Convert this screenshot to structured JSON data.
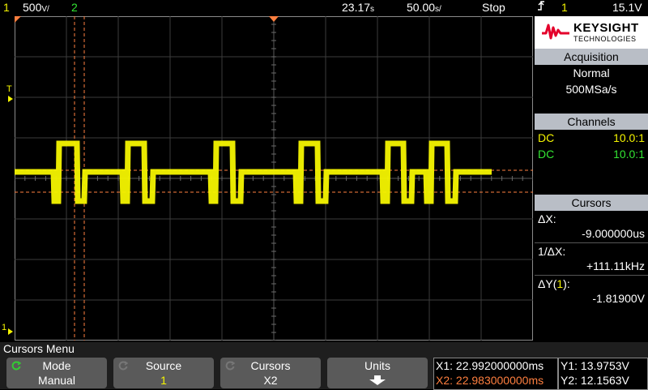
{
  "status_bar": {
    "ch1_num": "1",
    "ch1_scale": "500",
    "ch1_unit": "V/",
    "ch2_num": "2",
    "time_ref": "23.17",
    "time_ref_unit": "s",
    "timebase": "50.00",
    "timebase_unit": "s/",
    "run_state": "Stop",
    "trigger_icon": "trigger-edge-icon",
    "trig_ch": "1",
    "trig_level": "15.1V"
  },
  "logo": {
    "brand": "KEYSIGHT",
    "sub": "TECHNOLOGIES"
  },
  "acquisition": {
    "title": "Acquisition",
    "mode": "Normal",
    "rate": "500MSa/s"
  },
  "channels": {
    "title": "Channels",
    "rows": [
      {
        "coupling": "DC",
        "ratio": "10.0:1",
        "color": "#f5f500"
      },
      {
        "coupling": "DC",
        "ratio": "10.0:1",
        "color": "#33e533"
      }
    ]
  },
  "cursors": {
    "title": "Cursors",
    "dx_label": "ΔX:",
    "dx_value": "-9.000000us",
    "inv_dx_label": "1/ΔX:",
    "inv_dx_value": "+111.11kHz",
    "dy_label_pre": "ΔY(",
    "dy_label_ch": "1",
    "dy_label_post": "):",
    "dy_value": "-1.81900V"
  },
  "menu": {
    "title": "Cursors Menu",
    "softkeys": [
      {
        "label": "Mode",
        "value": "Manual"
      },
      {
        "label": "Source",
        "value": "1"
      },
      {
        "label": "Cursors",
        "value": "X2"
      },
      {
        "label": "Units",
        "value": ""
      }
    ]
  },
  "readouts": {
    "x1": "X1: 22.992000000ms",
    "x2": "X2: 22.983000000ms",
    "y1": "Y1: 13.9753V",
    "y2": "Y2: 12.1563V"
  },
  "colors": {
    "ch1": "#f5f500",
    "ch2": "#33e533",
    "cursor": "#ff7f3f",
    "header_bg": "#b9bec6",
    "softkey_bg": "#5a5a5a",
    "rotary_icon": "#33cc33"
  },
  "waveform": {
    "channel": "1",
    "levels": {
      "idle": "mid",
      "high": "high",
      "low": "low"
    },
    "pattern": [
      {
        "state": "mid",
        "duration": 48
      },
      {
        "state": "low",
        "duration": 6
      },
      {
        "state": "high",
        "duration": 23
      },
      {
        "state": "low",
        "duration": 9
      },
      {
        "state": "mid",
        "duration": 47
      },
      {
        "state": "low",
        "duration": 6
      },
      {
        "state": "high",
        "duration": 21
      },
      {
        "state": "low",
        "duration": 10
      },
      {
        "state": "mid",
        "duration": 72
      },
      {
        "state": "low",
        "duration": 6
      },
      {
        "state": "high",
        "duration": 21
      },
      {
        "state": "low",
        "duration": 10
      },
      {
        "state": "mid",
        "duration": 68
      },
      {
        "state": "low",
        "duration": 6
      },
      {
        "state": "high",
        "duration": 21
      },
      {
        "state": "low",
        "duration": 10
      },
      {
        "state": "mid",
        "duration": 70
      },
      {
        "state": "low",
        "duration": 6
      },
      {
        "state": "high",
        "duration": 20
      },
      {
        "state": "low",
        "duration": 10
      },
      {
        "state": "mid",
        "duration": 18
      },
      {
        "state": "low",
        "duration": 6
      },
      {
        "state": "high",
        "duration": 20
      },
      {
        "state": "low",
        "duration": 10
      },
      {
        "state": "mid",
        "duration": 45
      }
    ]
  }
}
